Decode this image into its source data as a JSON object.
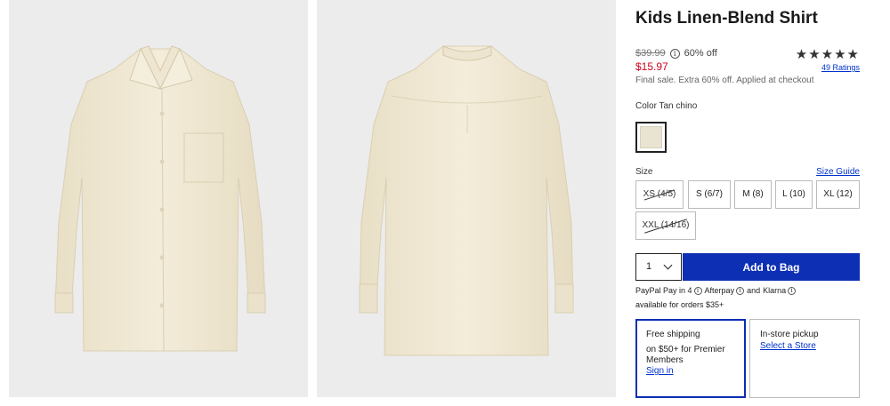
{
  "product": {
    "title": "Kids Linen-Blend Shirt",
    "original_price": "$39.99",
    "discount": "60% off",
    "sale_price": "$15.97",
    "final_sale_note": "Final sale. Extra 60% off. Applied at checkout",
    "stars": "★★★★★",
    "rating_value": 5,
    "ratings_link": "49 Ratings"
  },
  "color": {
    "label": "Color Tan chino",
    "swatch_hex": "#e9e3d2"
  },
  "size": {
    "label": "Size",
    "guide_link": "Size Guide",
    "options": [
      {
        "label": "XS (4/5)",
        "available": false
      },
      {
        "label": "S (6/7)",
        "available": true
      },
      {
        "label": "M (8)",
        "available": true
      },
      {
        "label": "L (10)",
        "available": true
      },
      {
        "label": "XL (12)",
        "available": true
      },
      {
        "label": "XXL (14/16)",
        "available": false
      }
    ]
  },
  "purchase": {
    "quantity": "1",
    "add_to_bag": "Add to Bag"
  },
  "payment": {
    "paypal": "PayPal Pay in 4",
    "afterpay": "Afterpay",
    "and": "and",
    "klarna": "Klarna",
    "info_glyph": "i",
    "availability": "available for orders $35+"
  },
  "fulfillment": {
    "shipping_title": "Free shipping",
    "shipping_detail": "on $50+ for Premier Members",
    "sign_in": "Sign in",
    "pickup_title": "In-store pickup",
    "select_store": "Select a Store"
  },
  "colors": {
    "accent": "#0d2fb4",
    "sale": "#d0021b",
    "link": "#0033cc",
    "photo_bg": "#ececec",
    "shirt": "#f1ead6"
  }
}
